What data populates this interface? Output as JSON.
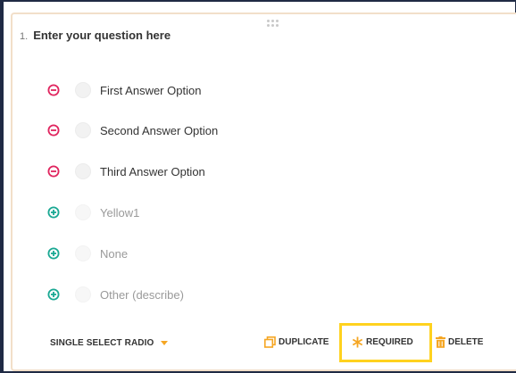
{
  "question": {
    "number": "1.",
    "text": "Enter your question here"
  },
  "options": [
    {
      "label": "First Answer Option",
      "icon": "remove-circle-icon",
      "state": "active"
    },
    {
      "label": "Second Answer Option",
      "icon": "remove-circle-icon",
      "state": "active"
    },
    {
      "label": "Third Answer Option",
      "icon": "remove-circle-icon",
      "state": "active"
    },
    {
      "label": "Yellow1",
      "icon": "add-circle-icon",
      "state": "suggested"
    },
    {
      "label": "None",
      "icon": "add-circle-icon",
      "state": "suggested"
    },
    {
      "label": "Other (describe)",
      "icon": "add-circle-icon",
      "state": "suggested"
    }
  ],
  "footer": {
    "question_type": "SINGLE SELECT RADIO",
    "duplicate_label": "DUPLICATE",
    "required_label": "REQUIRED",
    "delete_label": "DELETE"
  },
  "colors": {
    "remove": "#e0245e",
    "add": "#1aa893",
    "accent": "#f5a623",
    "highlight": "#ffd21f",
    "card_border": "#f2dfc9"
  }
}
